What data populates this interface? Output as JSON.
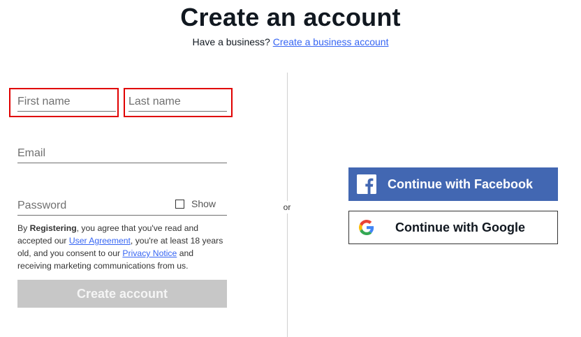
{
  "header": {
    "title": "Create an account",
    "business_prompt": "Have a business?",
    "business_link": "Create a business account"
  },
  "form": {
    "first_name_placeholder": "First name",
    "last_name_placeholder": "Last name",
    "email_placeholder": "Email",
    "password_placeholder": "Password",
    "show_label": "Show",
    "legal": {
      "prefix": "By ",
      "registering": "Registering",
      "text1": ", you agree that you've read and accepted our ",
      "user_agreement": "User Agreement",
      "text2": ", you're at least 18 years old, and you consent to our ",
      "privacy_notice": "Privacy Notice",
      "text3": " and receiving marketing communications from us."
    },
    "create_button": "Create account"
  },
  "divider": {
    "or_label": "or"
  },
  "social": {
    "facebook_label": "Continue with Facebook",
    "google_label": "Continue with Google"
  },
  "colors": {
    "link": "#3665f3",
    "facebook": "#4267b2",
    "highlight": "#e00000",
    "disabled_button": "#c7c7c7"
  },
  "icons": {
    "facebook": "facebook-icon",
    "google": "google-icon",
    "checkbox": "checkbox-icon"
  }
}
